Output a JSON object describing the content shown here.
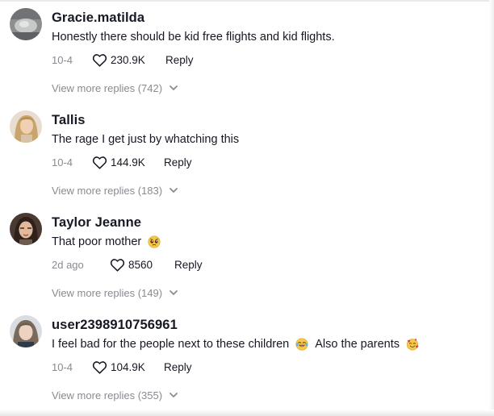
{
  "comments": [
    {
      "username": "Gracie.matilda",
      "text": "Honestly there should be kid free flights and kid flights.",
      "emoji": "",
      "emoji2": "",
      "date": "10-4",
      "likes": "230.9K",
      "reply_label": "Reply",
      "view_more": "View more replies (742)"
    },
    {
      "username": "Tallis",
      "text": "The rage I get just by whatching this",
      "emoji": "",
      "emoji2": "",
      "date": "10-4",
      "likes": "144.9K",
      "reply_label": "Reply",
      "view_more": "View more replies (183)"
    },
    {
      "username": "Taylor Jeanne",
      "text": "That poor mother",
      "emoji": "pleading-face",
      "emoji2": "",
      "date": "2d ago",
      "likes": "8560",
      "reply_label": "Reply",
      "view_more": "View more replies (149)"
    },
    {
      "username": "user2398910756961",
      "text": "I feel bad for the people next to these children",
      "emoji": "laughing-tears-face",
      "text2": "Also the parents",
      "emoji2": "smiling-face-with-hearts",
      "date": "10-4",
      "likes": "104.9K",
      "reply_label": "Reply",
      "view_more": "View more replies (355)"
    }
  ],
  "colors": {
    "text": "#161823",
    "muted": "#8a8b91",
    "background": "#ffffff"
  },
  "icons": {
    "like": "heart-outline-icon",
    "expand": "chevron-down-icon"
  }
}
